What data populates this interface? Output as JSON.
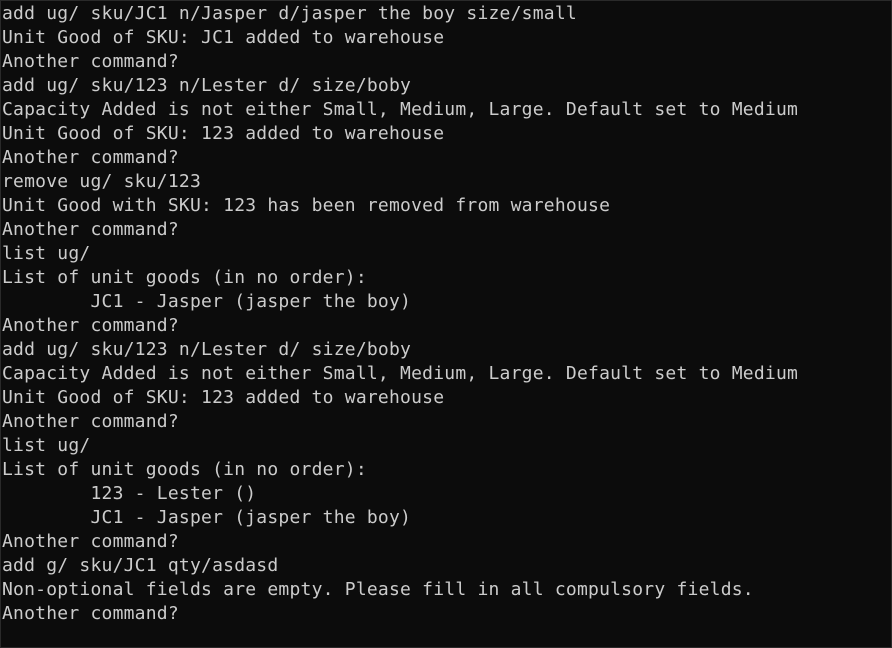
{
  "terminal": {
    "lines": [
      "add ug/ sku/JC1 n/Jasper d/jasper the boy size/small",
      "Unit Good of SKU: JC1 added to warehouse",
      "Another command?",
      "add ug/ sku/123 n/Lester d/ size/boby",
      "Capacity Added is not either Small, Medium, Large. Default set to Medium",
      "Unit Good of SKU: 123 added to warehouse",
      "Another command?",
      "remove ug/ sku/123",
      "Unit Good with SKU: 123 has been removed from warehouse",
      "Another command?",
      "list ug/",
      "List of unit goods (in no order):",
      "        JC1 - Jasper (jasper the boy)",
      "Another command?",
      "add ug/ sku/123 n/Lester d/ size/boby",
      "Capacity Added is not either Small, Medium, Large. Default set to Medium",
      "Unit Good of SKU: 123 added to warehouse",
      "Another command?",
      "list ug/",
      "List of unit goods (in no order):",
      "        123 - Lester ()",
      "        JC1 - Jasper (jasper the boy)",
      "Another command?",
      "add g/ sku/JC1 qty/asdasd",
      "Non-optional fields are empty. Please fill in all compulsory fields.",
      "Another command?"
    ]
  }
}
